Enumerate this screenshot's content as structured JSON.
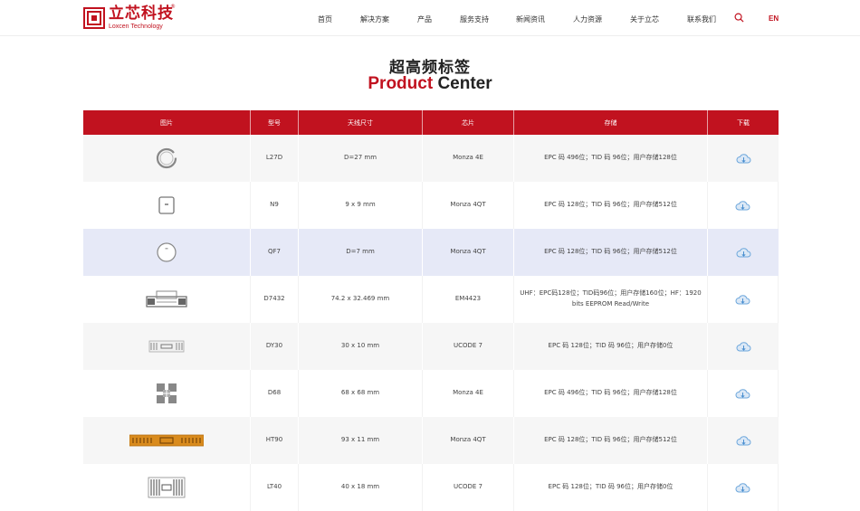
{
  "brand": {
    "name_cn": "立芯科技",
    "name_en": "Loxcen Technology",
    "reg": "®"
  },
  "nav": [
    {
      "label": "首页"
    },
    {
      "label": "解决方案"
    },
    {
      "label": "产品"
    },
    {
      "label": "服务支持"
    },
    {
      "label": "新闻资讯"
    },
    {
      "label": "人力资源"
    },
    {
      "label": "关于立芯"
    },
    {
      "label": "联系我们"
    }
  ],
  "lang": "EN",
  "icons": {
    "search": "search-icon",
    "download": "cloud-download-icon"
  },
  "colors": {
    "accent": "#c1121f",
    "highlight_row": "#e6e9f7",
    "cloud": "#6fa8dc"
  },
  "page": {
    "title_cn": "超高频标签",
    "title_en_a": "Product",
    "title_en_b": "Center"
  },
  "table": {
    "headers": [
      "图片",
      "型号",
      "天线尺寸",
      "芯片",
      "存储",
      "下载"
    ],
    "rows": [
      {
        "model": "L27D",
        "size": "D=27 mm",
        "chip": "Monza 4E",
        "storage": "EPC 码 496位；TID 码 96位；用户存储128位",
        "img": "ring-tag"
      },
      {
        "model": "N9",
        "size": "9 x 9 mm",
        "chip": "Monza 4QT",
        "storage": "EPC 码 128位；TID 码 96位；用户存储512位",
        "img": "square-tag"
      },
      {
        "model": "QF7",
        "size": "D=7 mm",
        "chip": "Monza 4QT",
        "storage": "EPC 码 128位；TID 码 96位；用户存储512位",
        "img": "round-tag"
      },
      {
        "model": "D7432",
        "size": "74.2 x 32.469 mm",
        "chip": "EM4423",
        "storage": "UHF：EPC码128位；TID码96位；用户存储160位；HF：1920 bits EEPROM Read/Write",
        "img": "dual-tag"
      },
      {
        "model": "DY30",
        "size": "30 x 10 mm",
        "chip": "UCODE 7",
        "storage": "EPC 码 128位；TID 码 96位；用户存储0位",
        "img": "strip-tag"
      },
      {
        "model": "D68",
        "size": "68 x 68 mm",
        "chip": "Monza 4E",
        "storage": "EPC 码 496位；TID 码 96位；用户存储128位",
        "img": "cross-tag"
      },
      {
        "model": "HT90",
        "size": "93 x 11 mm",
        "chip": "Monza 4QT",
        "storage": "EPC 码 128位；TID 码 96位；用户存储512位",
        "img": "long-tag"
      },
      {
        "model": "LT40",
        "size": "40 x 18 mm",
        "chip": "UCODE 7",
        "storage": "EPC 码 128位；TID 码 96位；用户存储0位",
        "img": "meander-tag"
      }
    ]
  }
}
